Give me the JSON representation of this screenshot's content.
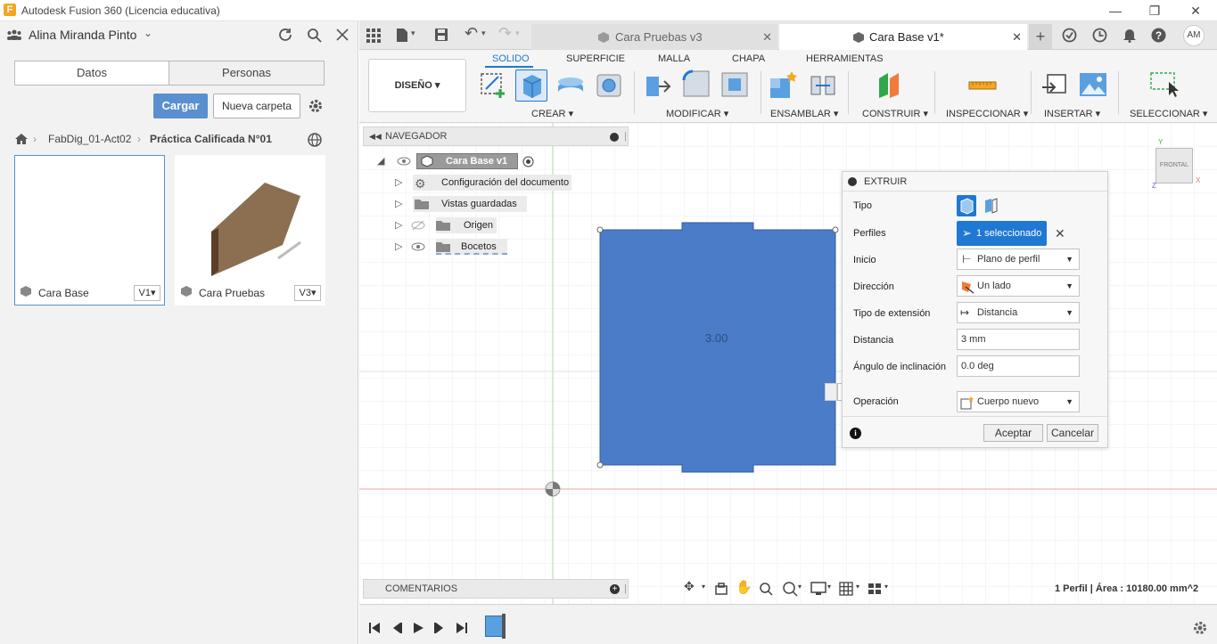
{
  "window": {
    "title": "Autodesk Fusion 360 (Licencia educativa)",
    "logo": "F"
  },
  "left": {
    "user": "Alina Miranda Pinto",
    "tabs": [
      "Datos",
      "Personas"
    ],
    "upload_label": "Cargar",
    "new_folder_label": "Nueva carpeta",
    "breadcrumb": [
      "FabDig_01-Act02",
      "Práctica Calificada N°01"
    ],
    "files": [
      {
        "name": "Cara Base",
        "version": "V1"
      },
      {
        "name": "Cara Pruebas",
        "version": "V3"
      }
    ]
  },
  "tabs": [
    {
      "label": "Cara Pruebas v3"
    },
    {
      "label": "Cara Base v1*"
    }
  ],
  "user_initials": "AM",
  "toolbar": {
    "workspace": "DISEÑO",
    "ribbon_tabs": [
      "SOLIDO",
      "SUPERFICIE",
      "MALLA",
      "CHAPA",
      "HERRAMIENTAS"
    ],
    "groups": [
      "CREAR",
      "MODIFICAR",
      "ENSAMBLAR",
      "CONSTRUIR",
      "INSPECCIONAR",
      "INSERTAR",
      "SELECCIONAR"
    ]
  },
  "navigator": {
    "title": "NAVEGADOR",
    "root": "Cara Base v1",
    "items": [
      "Configuración del documento",
      "Vistas guardadas",
      "Origen",
      "Bocetos"
    ]
  },
  "canvas": {
    "dimension_label": "3.00",
    "viewcube_label": "FRONTAL",
    "inline_value": "3"
  },
  "dialog": {
    "title": "EXTRUIR",
    "rows": {
      "tipo": "Tipo",
      "perfiles": "Perfiles",
      "perfiles_value": "1 seleccionado",
      "inicio": "Inicio",
      "inicio_value": "Plano de perfil",
      "direccion": "Dirección",
      "direccion_value": "Un lado",
      "tipo_ext": "Tipo de extensión",
      "tipo_ext_value": "Distancia",
      "distancia": "Distancia",
      "distancia_value": "3 mm",
      "angulo": "Ángulo de inclinación",
      "angulo_value": "0.0 deg",
      "operacion": "Operación",
      "operacion_value": "Cuerpo nuevo"
    },
    "ok": "Aceptar",
    "cancel": "Cancelar"
  },
  "comments_title": "COMENTARIOS",
  "status": "1 Perfil | Área : 10180.00 mm^2",
  "colors": {
    "accent": "#1f78d1",
    "profile": "#4a7cc7",
    "button_blue": "#5a8fd0"
  }
}
